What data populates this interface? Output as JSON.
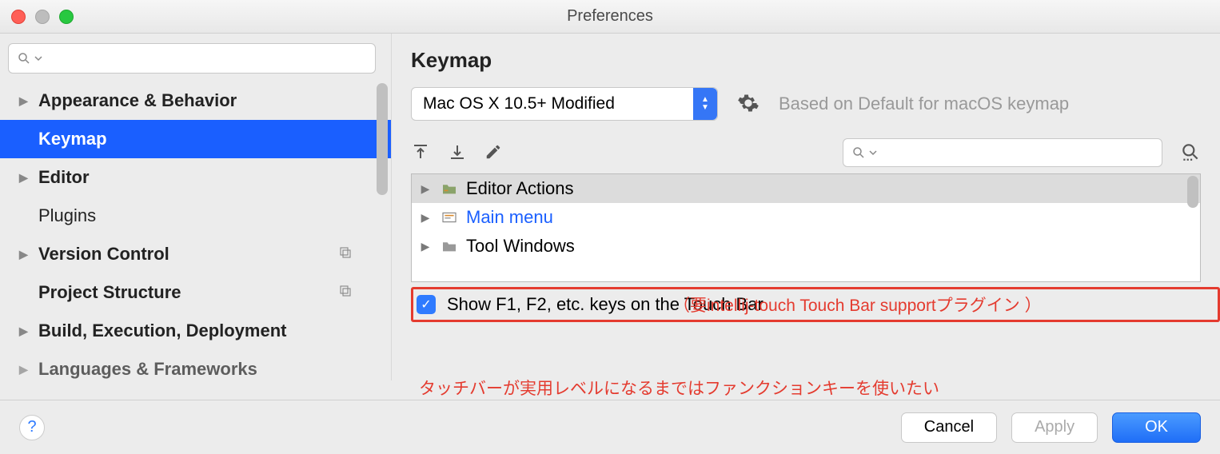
{
  "window": {
    "title": "Preferences"
  },
  "sidebar": {
    "search_placeholder": "",
    "items": [
      {
        "label": "Appearance & Behavior",
        "expandable": true,
        "bold": true
      },
      {
        "label": "Keymap",
        "expandable": false,
        "bold": true,
        "selected": true
      },
      {
        "label": "Editor",
        "expandable": true,
        "bold": true
      },
      {
        "label": "Plugins",
        "expandable": false,
        "bold": false
      },
      {
        "label": "Version Control",
        "expandable": true,
        "bold": true,
        "icon": "copy"
      },
      {
        "label": "Project Structure",
        "expandable": false,
        "bold": true,
        "icon": "copy"
      },
      {
        "label": "Build, Execution, Deployment",
        "expandable": true,
        "bold": true
      },
      {
        "label": "Languages & Frameworks",
        "expandable": true,
        "bold": true
      }
    ]
  },
  "main": {
    "title": "Keymap",
    "profile_selected": "Mac OS X 10.5+ Modified",
    "based_on": "Based on Default for macOS keymap",
    "action_search_placeholder": "",
    "tree": [
      {
        "label": "Editor Actions",
        "selected": true,
        "icon": "folder-green"
      },
      {
        "label": "Main menu",
        "link": true,
        "icon": "menu"
      },
      {
        "label": "Tool Windows",
        "icon": "folder"
      }
    ],
    "checkbox_label": "Show F1, F2, etc. keys on the Touch Bar",
    "checkbox_checked": true
  },
  "annotations": {
    "a1": "（要intellij-touch Touch Bar supportプラグイン ）",
    "a2": "タッチバーが実用レベルになるまではファンクションキーを使いたい"
  },
  "footer": {
    "help": "?",
    "cancel": "Cancel",
    "apply": "Apply",
    "ok": "OK"
  }
}
